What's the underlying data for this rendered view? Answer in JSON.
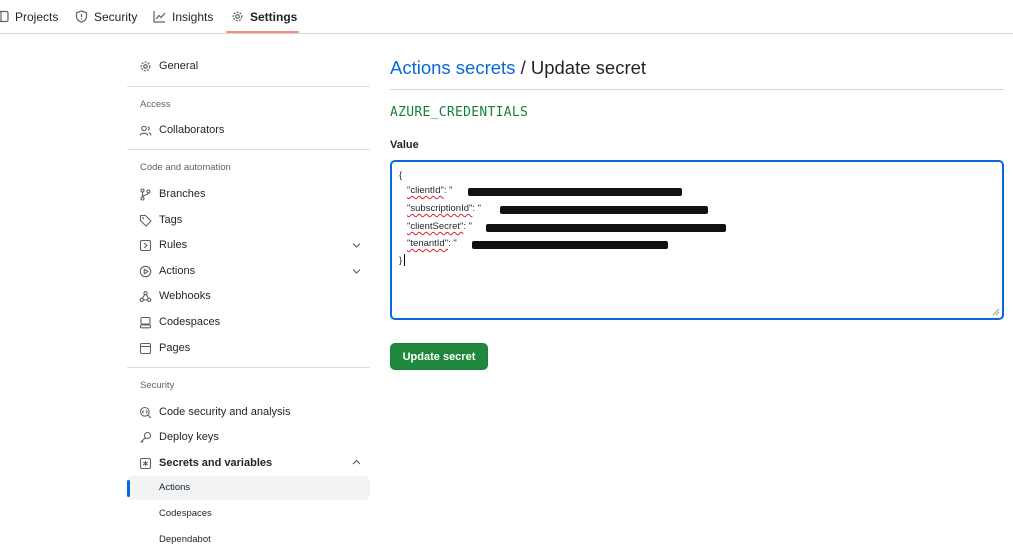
{
  "topnav": {
    "tabs": [
      {
        "label": "Projects",
        "icon": "table-icon"
      },
      {
        "label": "Security",
        "icon": "shield-icon"
      },
      {
        "label": "Insights",
        "icon": "graph-icon"
      },
      {
        "label": "Settings",
        "icon": "gear-icon",
        "active": true
      }
    ]
  },
  "sidebar": {
    "general": "General",
    "access_heading": "Access",
    "collaborators": "Collaborators",
    "code_heading": "Code and automation",
    "branches": "Branches",
    "tags": "Tags",
    "rules": "Rules",
    "actions": "Actions",
    "webhooks": "Webhooks",
    "codespaces": "Codespaces",
    "pages": "Pages",
    "security_heading": "Security",
    "code_security": "Code security and analysis",
    "deploy_keys": "Deploy keys",
    "secrets_vars": "Secrets and variables",
    "sub_items": [
      "Actions",
      "Codespaces",
      "Dependabot"
    ]
  },
  "main": {
    "breadcrumb_link": "Actions secrets",
    "breadcrumb_sep": " / ",
    "title": "Update secret",
    "secret_name": "AZURE_CREDENTIALS",
    "value_label": "Value",
    "value_lines": {
      "open": "{",
      "client_id_key": "\"clientId\"",
      "subscription_id_key": "\"subscriptionId\"",
      "client_secret_key": "\"clientSecret\"",
      "tenant_id_key": "\"tenantId\"",
      "colon_quote": ": \"",
      "close": "}"
    },
    "submit_label": "Update secret"
  },
  "colors": {
    "accent": "#0969da",
    "success": "#1f883d",
    "active_tab_underline": "#fd8c73"
  }
}
